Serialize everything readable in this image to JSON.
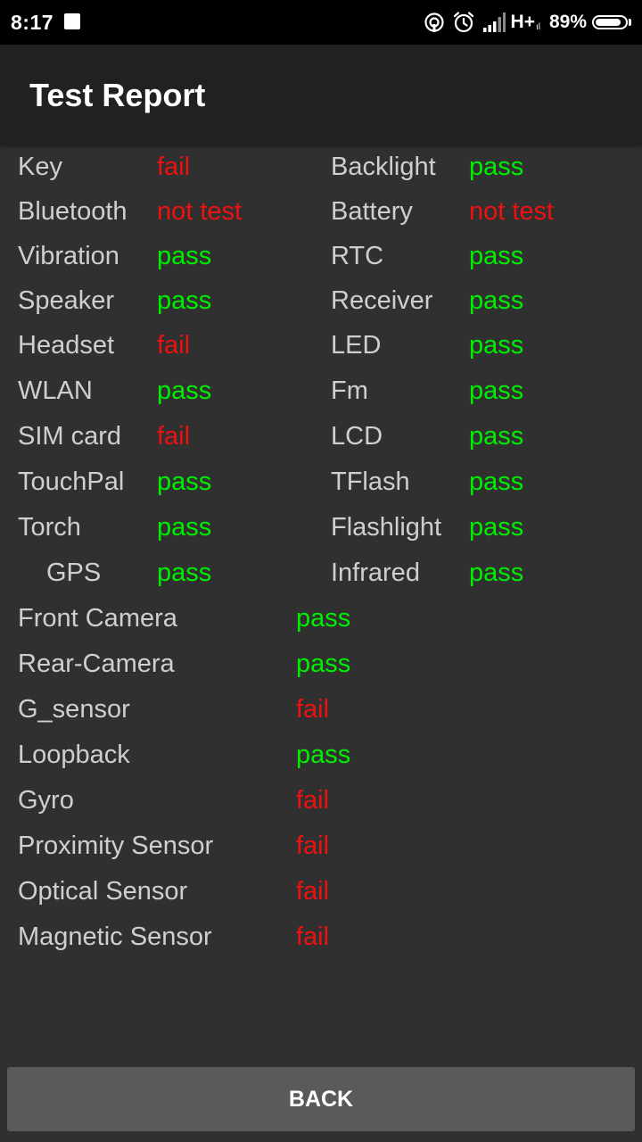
{
  "status_bar": {
    "time": "8:17",
    "network": "H+",
    "network_sub": "ıl",
    "battery_percent": "89%",
    "battery_level": 0.89
  },
  "app_bar": {
    "title": "Test Report"
  },
  "colors": {
    "pass": "#00ee00",
    "fail": "#ee1111",
    "label": "#cfcfcf"
  },
  "report": {
    "pairs": [
      {
        "left": {
          "label": "Key",
          "result": "fail"
        },
        "right": {
          "label": "Backlight",
          "result": "pass"
        }
      },
      {
        "left": {
          "label": "Bluetooth",
          "result": "not test"
        },
        "right": {
          "label": "Battery",
          "result": "not test"
        }
      },
      {
        "left": {
          "label": "Vibration",
          "result": "pass"
        },
        "right": {
          "label": "RTC",
          "result": "pass"
        }
      },
      {
        "left": {
          "label": "Speaker",
          "result": "pass"
        },
        "right": {
          "label": "Receiver",
          "result": "pass"
        }
      },
      {
        "left": {
          "label": "Headset",
          "result": "fail"
        },
        "right": {
          "label": "LED",
          "result": "pass"
        }
      },
      {
        "left": {
          "label": "WLAN",
          "result": "pass"
        },
        "right": {
          "label": "Fm",
          "result": "pass"
        }
      },
      {
        "left": {
          "label": "SIM card",
          "result": "fail"
        },
        "right": {
          "label": "LCD",
          "result": "pass"
        }
      },
      {
        "left": {
          "label": "TouchPal",
          "result": "pass"
        },
        "right": {
          "label": "TFlash",
          "result": "pass"
        }
      },
      {
        "left": {
          "label": "Torch",
          "result": "pass"
        },
        "right": {
          "label": "Flashlight",
          "result": "pass"
        }
      },
      {
        "left": {
          "label": "GPS",
          "result": "pass"
        },
        "right": {
          "label": "Infrared",
          "result": "pass"
        }
      }
    ],
    "singles": [
      {
        "label": "Front Camera",
        "result": "pass"
      },
      {
        "label": "Rear-Camera",
        "result": "pass"
      },
      {
        "label": "G_sensor",
        "result": "fail"
      },
      {
        "label": "Loopback",
        "result": "pass"
      },
      {
        "label": "Gyro",
        "result": "fail"
      },
      {
        "label": "Proximity Sensor",
        "result": "fail"
      },
      {
        "label": "Optical Sensor",
        "result": "fail"
      },
      {
        "label": "Magnetic Sensor",
        "result": "fail"
      }
    ]
  },
  "footer": {
    "back_label": "BACK"
  }
}
